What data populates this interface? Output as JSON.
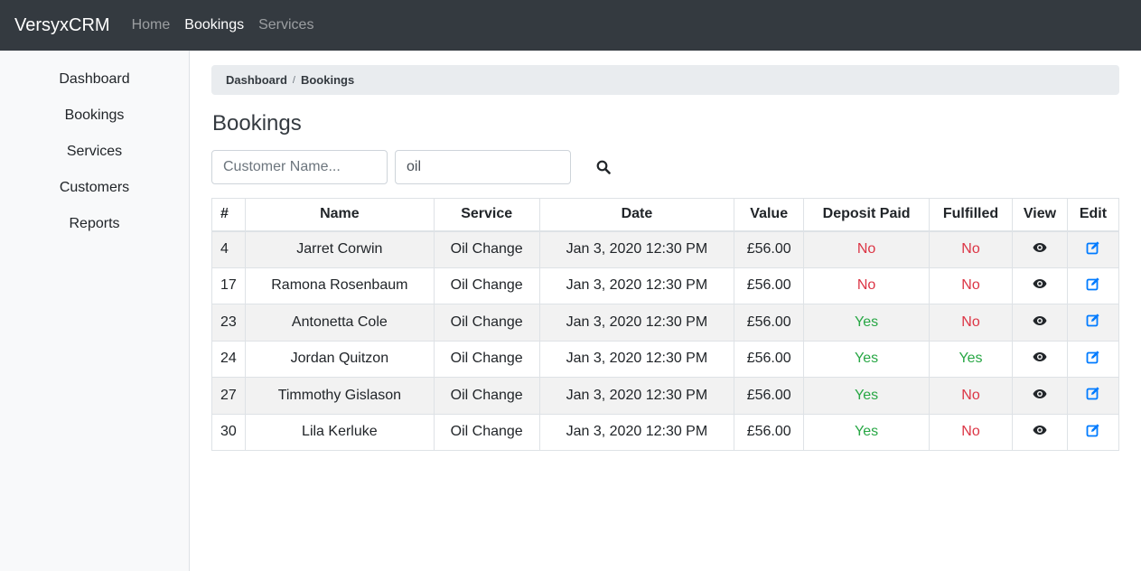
{
  "nav": {
    "brand": "VersyxCRM",
    "links": [
      "Home",
      "Bookings",
      "Services"
    ],
    "active": "Bookings"
  },
  "sidebar": {
    "items": [
      {
        "label": "Dashboard"
      },
      {
        "label": "Bookings"
      },
      {
        "label": "Services"
      },
      {
        "label": "Customers"
      },
      {
        "label": "Reports"
      }
    ]
  },
  "breadcrumb": {
    "items": [
      "Dashboard",
      "Bookings"
    ],
    "separator": "/"
  },
  "page": {
    "title": "Bookings"
  },
  "search": {
    "name_placeholder": "Customer Name...",
    "name_value": "",
    "service_value": "oil",
    "icon": "search-icon"
  },
  "table": {
    "headers": [
      "#",
      "Name",
      "Service",
      "Date",
      "Value",
      "Deposit Paid",
      "Fulfilled",
      "View",
      "Edit"
    ],
    "rows": [
      {
        "id": "4",
        "name": "Jarret Corwin",
        "service": "Oil Change",
        "date": "Jan 3, 2020 12:30 PM",
        "value": "£56.00",
        "deposit": "No",
        "fulfilled": "No"
      },
      {
        "id": "17",
        "name": "Ramona Rosenbaum",
        "service": "Oil Change",
        "date": "Jan 3, 2020 12:30 PM",
        "value": "£56.00",
        "deposit": "No",
        "fulfilled": "No"
      },
      {
        "id": "23",
        "name": "Antonetta Cole",
        "service": "Oil Change",
        "date": "Jan 3, 2020 12:30 PM",
        "value": "£56.00",
        "deposit": "Yes",
        "fulfilled": "No"
      },
      {
        "id": "24",
        "name": "Jordan Quitzon",
        "service": "Oil Change",
        "date": "Jan 3, 2020 12:30 PM",
        "value": "£56.00",
        "deposit": "Yes",
        "fulfilled": "Yes"
      },
      {
        "id": "27",
        "name": "Timmothy Gislason",
        "service": "Oil Change",
        "date": "Jan 3, 2020 12:30 PM",
        "value": "£56.00",
        "deposit": "Yes",
        "fulfilled": "No"
      },
      {
        "id": "30",
        "name": "Lila Kerluke",
        "service": "Oil Change",
        "date": "Jan 3, 2020 12:30 PM",
        "value": "£56.00",
        "deposit": "Yes",
        "fulfilled": "No"
      }
    ],
    "view_icon": "eye-icon",
    "edit_icon": "edit-icon"
  },
  "colors": {
    "navbar": "#343a40",
    "no": "#dc3545",
    "yes": "#28a745",
    "edit_icon": "#007bff"
  }
}
